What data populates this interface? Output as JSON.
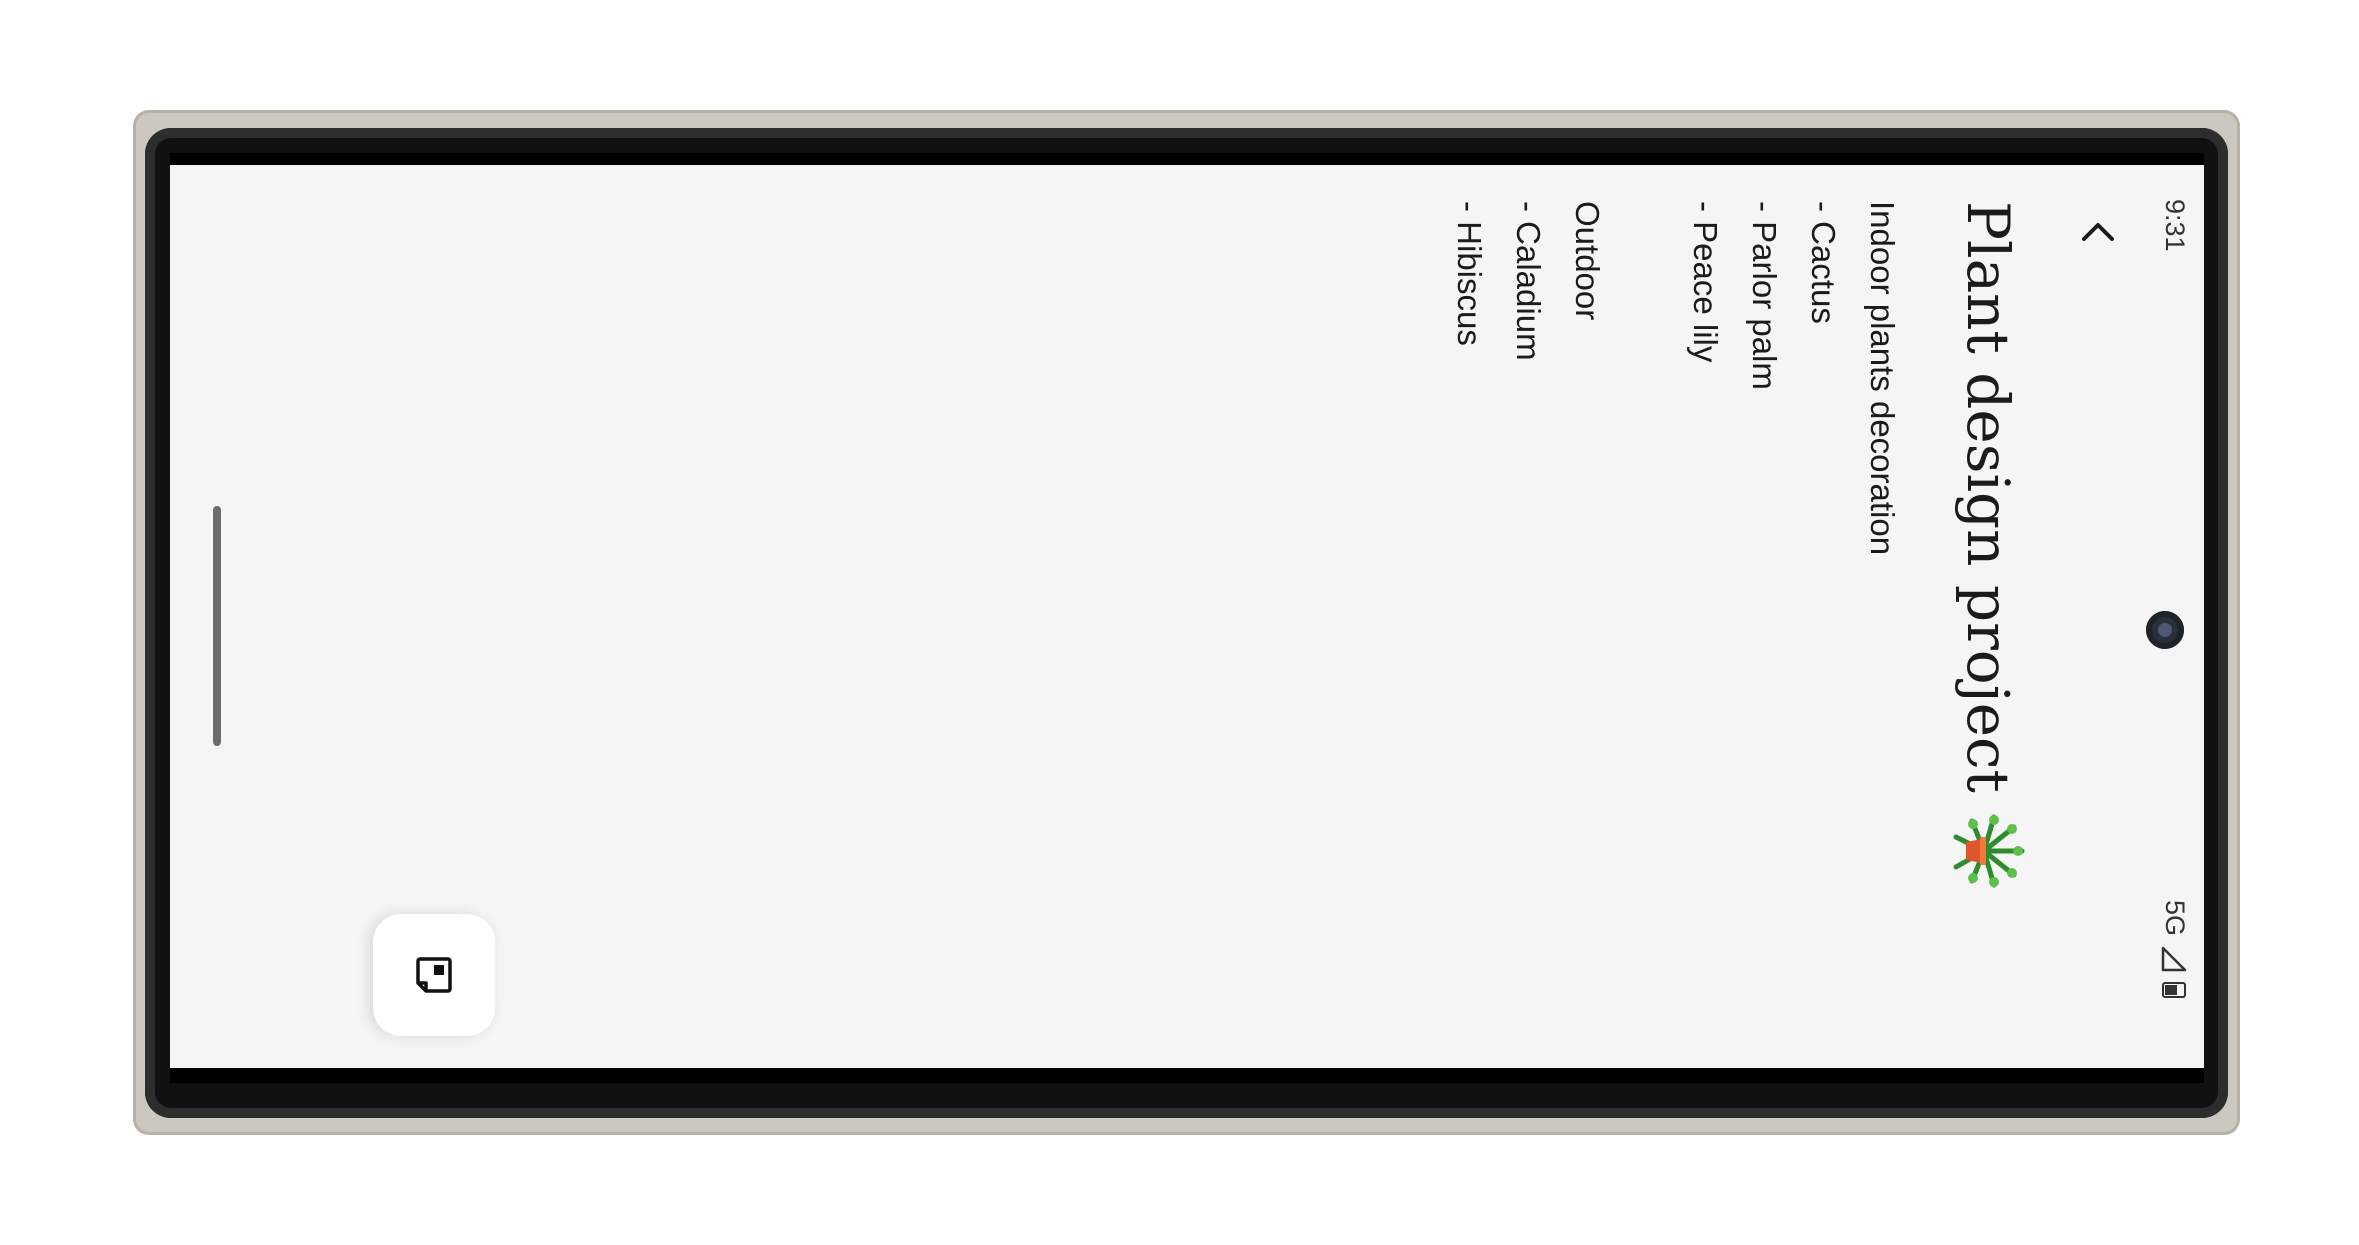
{
  "status_bar": {
    "time": "9:31",
    "network": "5G"
  },
  "icons": {
    "back": "chevron-left-icon",
    "plant": "potted-plant-icon",
    "fab": "note-card-icon",
    "signal": "signal-icon",
    "battery": "battery-icon"
  },
  "note": {
    "title": "Plant design project",
    "lines": [
      "Indoor plants decoration",
      "- Cactus",
      "- Parlor palm",
      "- Peace lily",
      "",
      "Outdoor",
      "- Caladium",
      "- Hibiscus"
    ]
  }
}
